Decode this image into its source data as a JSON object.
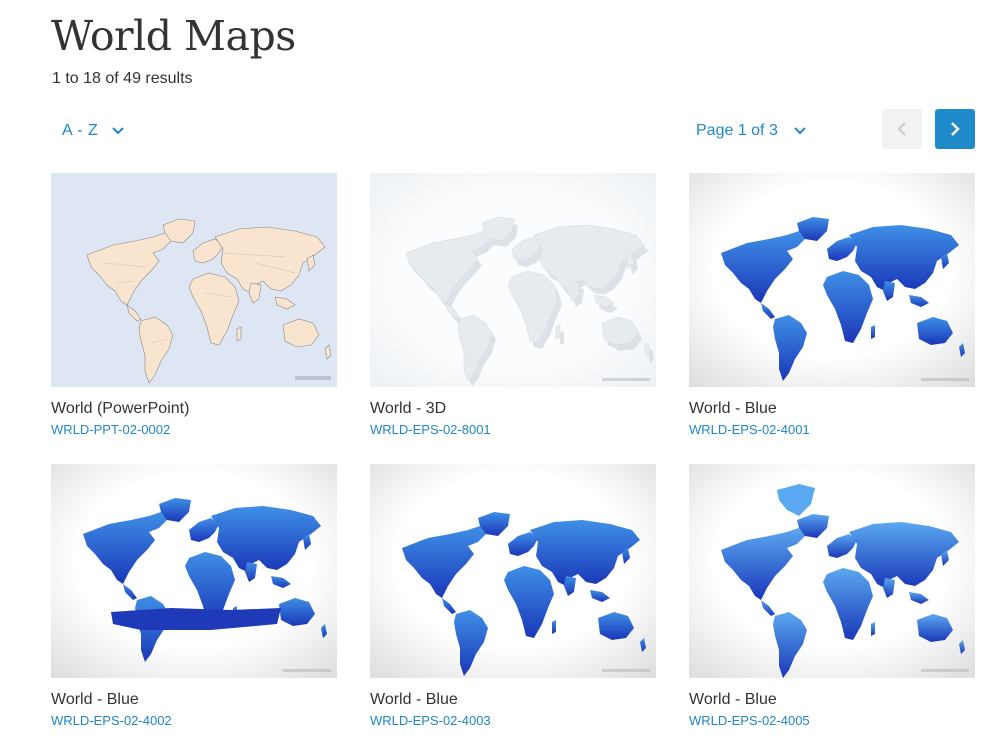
{
  "page": {
    "title": "World Maps",
    "results_text": "1 to 18 of 49 results"
  },
  "controls": {
    "sort_label": "A - Z",
    "page_label": "Page 1 of 3",
    "prev_icon": "chevron-left-icon",
    "next_icon": "chevron-right-icon"
  },
  "colors": {
    "accent": "#1f87c7",
    "next_button": "#1f8ac9",
    "prev_button": "#f1f2f3"
  },
  "products": [
    {
      "title": "World (PowerPoint)",
      "code": "WRLD-PPT-02-0002",
      "style": "political"
    },
    {
      "title": "World - 3D",
      "code": "WRLD-EPS-02-8001",
      "style": "3d"
    },
    {
      "title": "World - Blue",
      "code": "WRLD-EPS-02-4001",
      "style": "blue"
    },
    {
      "title": "World - Blue",
      "code": "WRLD-EPS-02-4002",
      "style": "blue-antarctica"
    },
    {
      "title": "World - Blue",
      "code": "WRLD-EPS-02-4003",
      "style": "blue"
    },
    {
      "title": "World - Blue",
      "code": "WRLD-EPS-02-4005",
      "style": "blue-greenland"
    }
  ]
}
